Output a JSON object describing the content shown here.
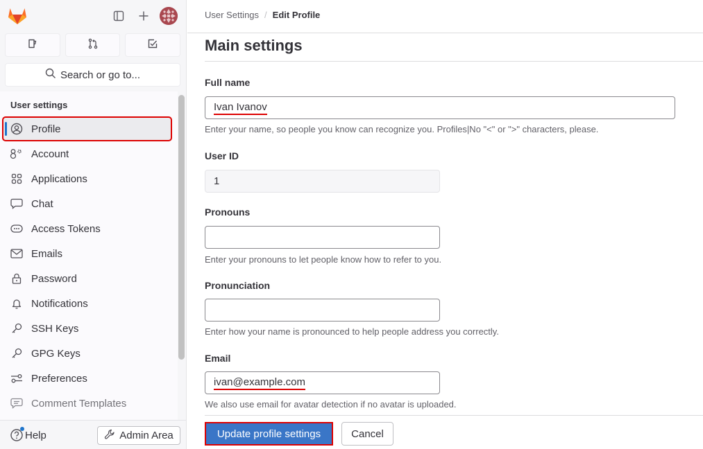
{
  "sidebar": {
    "search_label": "Search or go to...",
    "section_title": "User settings",
    "items": [
      {
        "label": "Profile",
        "icon": "profile-icon",
        "active": true
      },
      {
        "label": "Account",
        "icon": "account-icon"
      },
      {
        "label": "Applications",
        "icon": "applications-icon"
      },
      {
        "label": "Chat",
        "icon": "chat-icon"
      },
      {
        "label": "Access Tokens",
        "icon": "token-icon"
      },
      {
        "label": "Emails",
        "icon": "mail-icon"
      },
      {
        "label": "Password",
        "icon": "lock-icon"
      },
      {
        "label": "Notifications",
        "icon": "bell-icon"
      },
      {
        "label": "SSH Keys",
        "icon": "key-icon"
      },
      {
        "label": "GPG Keys",
        "icon": "key-icon"
      },
      {
        "label": "Preferences",
        "icon": "preferences-icon"
      },
      {
        "label": "Comment Templates",
        "icon": "comment-icon"
      }
    ],
    "help_label": "Help",
    "admin_label": "Admin Area"
  },
  "breadcrumb": {
    "parent": "User Settings",
    "separator": "/",
    "current": "Edit Profile"
  },
  "main": {
    "title": "Main settings",
    "full_name": {
      "label": "Full name",
      "value": "Ivan Ivanov",
      "help": "Enter your name, so people you know can recognize you. Profiles|No \"<\" or \">\" characters, please."
    },
    "user_id": {
      "label": "User ID",
      "value": "1"
    },
    "pronouns": {
      "label": "Pronouns",
      "value": "",
      "help": "Enter your pronouns to let people know how to refer to you."
    },
    "pronunciation": {
      "label": "Pronunciation",
      "value": "",
      "help": "Enter how your name is pronounced to help people address you correctly."
    },
    "email": {
      "label": "Email",
      "value": "ivan@example.com",
      "help": "We also use email for avatar detection if no avatar is uploaded."
    },
    "submit_label": "Update profile settings",
    "cancel_label": "Cancel"
  },
  "colors": {
    "primary": "#1f75cb",
    "highlight": "#dd0000",
    "logo": "#e24329"
  }
}
